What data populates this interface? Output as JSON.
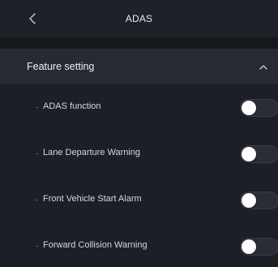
{
  "header": {
    "title": "ADAS",
    "back_icon": "chevron-left-icon"
  },
  "section": {
    "title": "Feature setting",
    "expanded": true,
    "chevron_icon": "chevron-up-icon"
  },
  "settings": [
    {
      "label": "ADAS function",
      "enabled": false
    },
    {
      "label": "Lane Departure Warning",
      "enabled": false
    },
    {
      "label": "Front Vehicle Start Alarm",
      "enabled": false
    },
    {
      "label": "Forward Collision Warning",
      "enabled": false
    }
  ],
  "colors": {
    "background": "#1b1e24",
    "header": "#1e2128",
    "section": "#272a31",
    "toggle_off": "#2a2d34",
    "knob": "#ffffff"
  }
}
